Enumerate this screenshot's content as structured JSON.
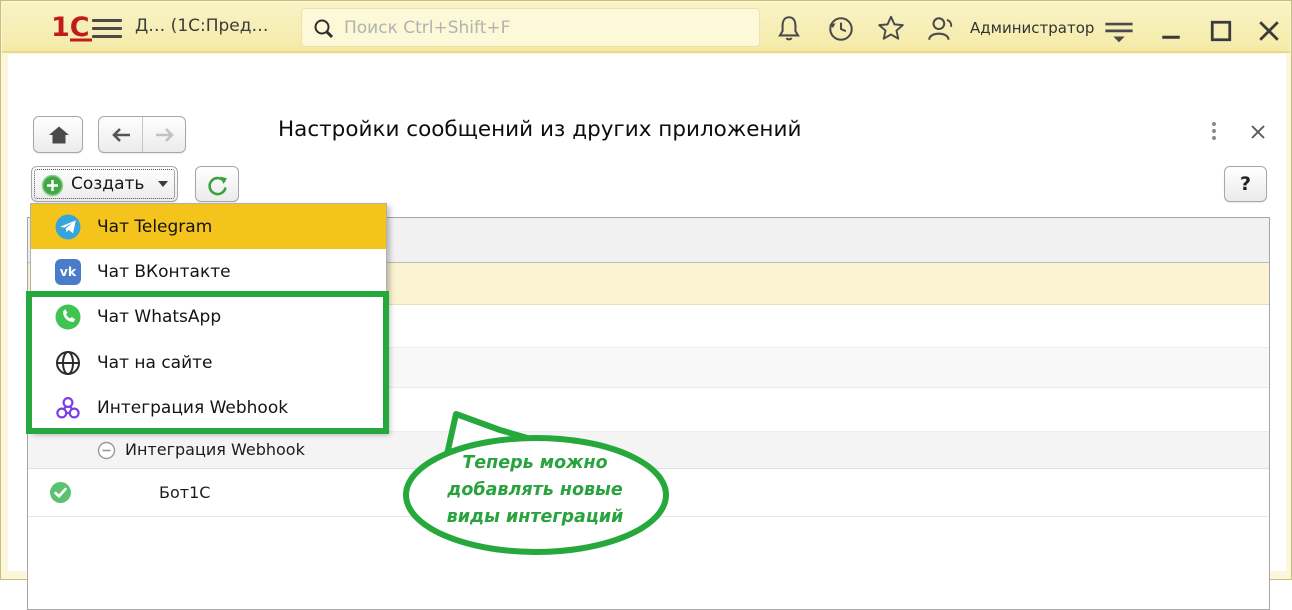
{
  "titlebar": {
    "logo_text": "1С",
    "app_title": "Д… (1С:Пред…",
    "search_placeholder": "Поиск Ctrl+Shift+F",
    "user_name": "Администратор"
  },
  "nav": {
    "page_title": "Настройки сообщений из других приложений"
  },
  "toolbar": {
    "create_label": "Создать",
    "help_label": "?"
  },
  "create_menu": {
    "items": [
      {
        "label": "Чат Telegram",
        "icon": "telegram-icon",
        "highlighted": true
      },
      {
        "label": "Чат ВКонтакте",
        "icon": "vk-icon",
        "badge": "vk",
        "highlighted": false
      },
      {
        "label": "Чат WhatsApp",
        "icon": "whatsapp-icon",
        "highlighted": false
      },
      {
        "label": "Чат на сайте",
        "icon": "globe-icon",
        "highlighted": false
      },
      {
        "label": "Интеграция Webhook",
        "icon": "webhook-icon",
        "highlighted": false
      }
    ]
  },
  "list": {
    "group_label": "Интеграция Webhook",
    "rows": [
      {
        "name": "Бот1С",
        "status_icon": "check-icon"
      }
    ]
  },
  "callout": {
    "line1": "Теперь можно",
    "line2": "добавлять новые",
    "line3": "виды интеграций"
  },
  "colors": {
    "titlebar_bg": "#f7f0ba",
    "menu_highlight": "#f5c41c",
    "selected_row_bg": "#fcf3d3",
    "accent_green": "#27a83c",
    "logo_red": "#c11b1b",
    "telegram_blue": "#35a6dc",
    "vk_blue": "#4a7cc9",
    "whatsapp_green": "#3fc351",
    "webhook_purple": "#7b3fe4"
  }
}
